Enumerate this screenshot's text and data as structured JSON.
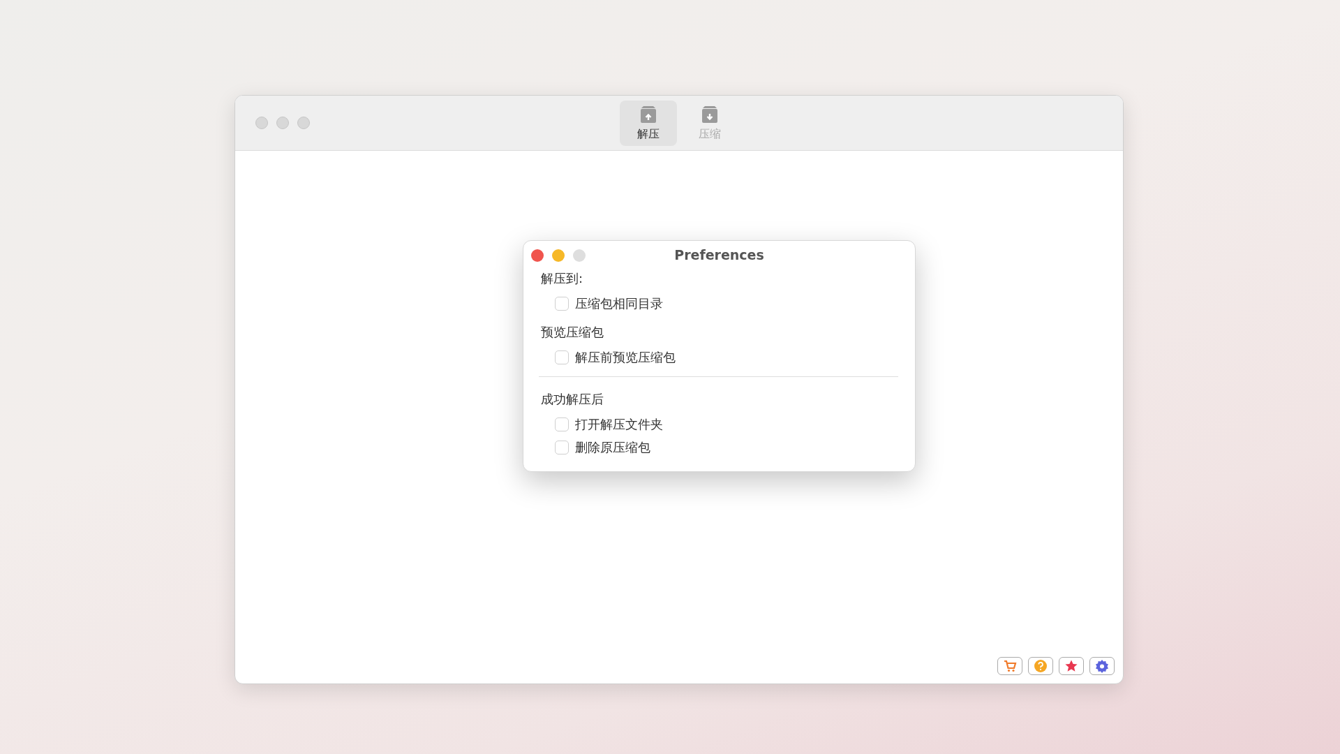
{
  "window": {
    "active": false,
    "tabs": [
      {
        "label": "解压",
        "kind": "extract",
        "selected": true
      },
      {
        "label": "压缩",
        "kind": "compress",
        "selected": false
      }
    ],
    "footer_buttons": [
      {
        "kind": "cart"
      },
      {
        "kind": "help"
      },
      {
        "kind": "star"
      },
      {
        "kind": "gear"
      }
    ]
  },
  "dialog": {
    "title": "Preferences",
    "traffic_lights": [
      {
        "kind": "close",
        "disabled": false
      },
      {
        "kind": "minimize",
        "disabled": false
      },
      {
        "kind": "zoom",
        "disabled": true
      }
    ],
    "groups": [
      {
        "heading": "解压到:",
        "separated": false,
        "options": [
          {
            "label": "压缩包相同目录",
            "checked": false
          }
        ]
      },
      {
        "heading": "预览压缩包",
        "separated": false,
        "options": [
          {
            "label": "解压前预览压缩包",
            "checked": false
          }
        ]
      },
      {
        "heading": "成功解压后",
        "separated": true,
        "options": [
          {
            "label": "打开解压文件夹",
            "checked": false
          },
          {
            "label": "删除原压缩包",
            "checked": false
          }
        ]
      }
    ]
  }
}
